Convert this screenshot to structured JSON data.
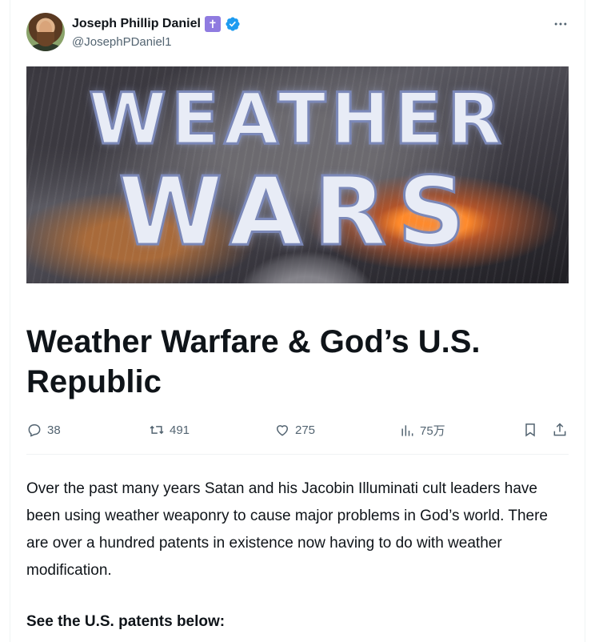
{
  "author": {
    "display_name": "Joseph Phillip Daniel",
    "badge_glyph": "✝",
    "handle": "@JosephPDaniel1",
    "verified_color": "#1d9bf0",
    "badge_color": "#8f7be0"
  },
  "menu": {
    "more_icon": "more-dots-icon"
  },
  "cover": {
    "line1": "WEATHER",
    "line2": "WARS"
  },
  "article": {
    "title": "Weather Warfare & God’s U.S. Republic",
    "body": "Over the past many years Satan and his Jacobin Illuminati cult leaders have been using weather weaponry to cause major problems in God’s world. There are over a hundred patents in existence now having to do with weather modification.",
    "subhead": "See the U.S. patents below:"
  },
  "stats": {
    "replies": "38",
    "reposts": "491",
    "likes": "275",
    "views": "75万"
  },
  "icons": [
    "reply-icon",
    "retweet-icon",
    "like-icon",
    "views-icon",
    "bookmark-icon",
    "share-icon"
  ]
}
